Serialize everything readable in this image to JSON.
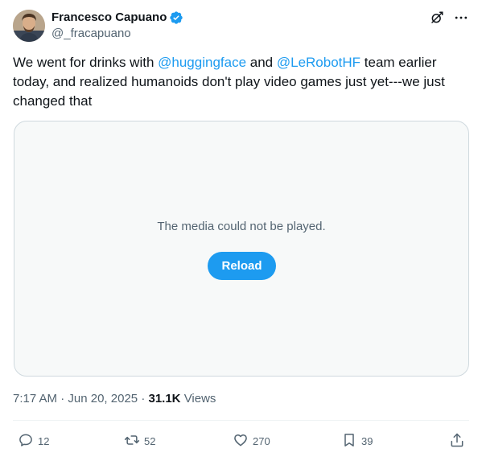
{
  "author": {
    "display_name": "Francesco Capuano",
    "handle": "@_fracapuano",
    "verified": true
  },
  "tweet": {
    "segments": [
      {
        "type": "text",
        "value": "We went for drinks with "
      },
      {
        "type": "mention",
        "value": "@huggingface"
      },
      {
        "type": "text",
        "value": " and "
      },
      {
        "type": "mention",
        "value": "@LeRobotHF"
      },
      {
        "type": "text",
        "value": "  team earlier today, and realized humanoids don't play video games just yet---we just changed that"
      }
    ]
  },
  "media": {
    "message": "The media could not be played.",
    "reload_label": "Reload"
  },
  "meta": {
    "time": "7:17 AM",
    "date": "Jun 20, 2025",
    "views_count": "31.1K",
    "views_label": "Views"
  },
  "actions": {
    "replies": "12",
    "reposts": "52",
    "likes": "270",
    "bookmarks": "39"
  },
  "icons": {
    "verified": "verified-badge-icon",
    "grok": "grok-icon",
    "more": "more-icon",
    "reply": "reply-icon",
    "repost": "repost-icon",
    "like": "heart-icon",
    "bookmark": "bookmark-icon",
    "share": "share-icon"
  },
  "colors": {
    "accent": "#1d9bf0",
    "text": "#0f1419",
    "secondary": "#536471",
    "media_bg": "#f7f9f9",
    "border": "#cfd9de"
  }
}
